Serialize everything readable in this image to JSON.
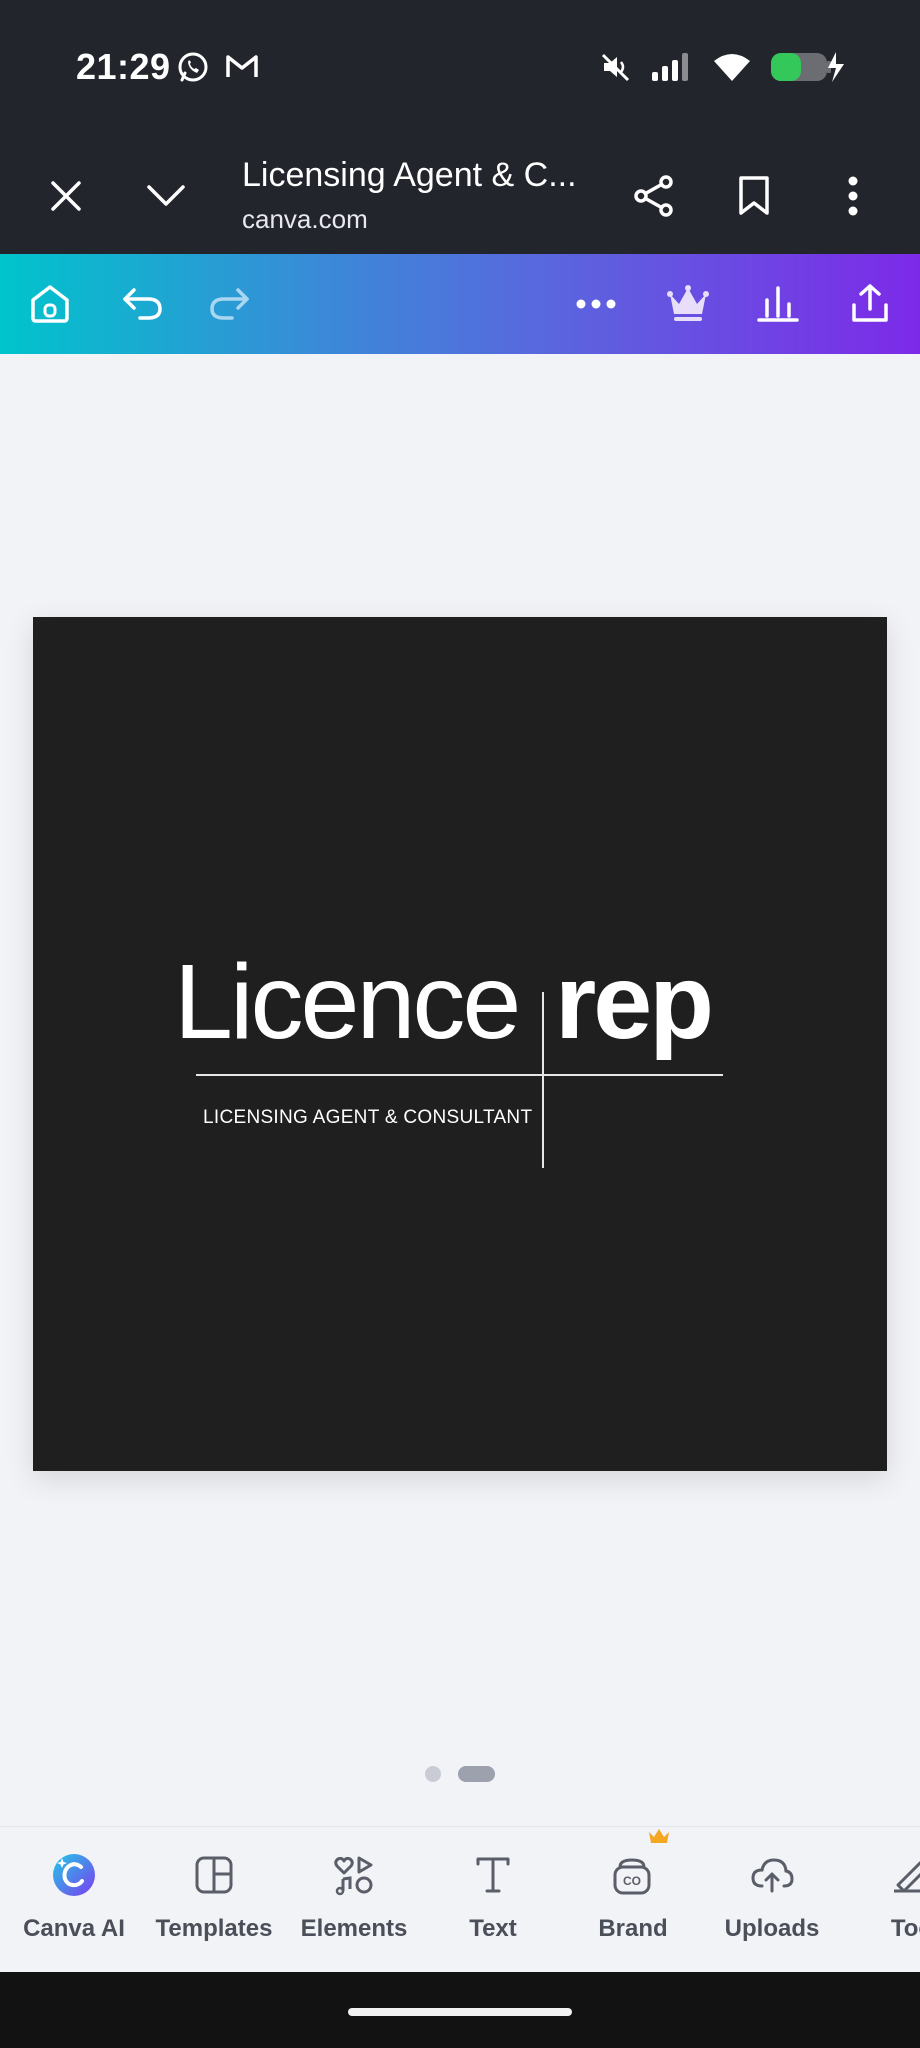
{
  "status_bar": {
    "time": "21:29",
    "icons": [
      "whatsapp-icon",
      "gmail-icon",
      "mute-icon",
      "signal-icon",
      "wifi-icon",
      "battery-charging-icon"
    ],
    "battery_color": "#34c759"
  },
  "browser": {
    "title": "Licensing Agent & C...",
    "url": "canva.com",
    "icons": [
      "close-icon",
      "chevron-down-icon",
      "share-icon",
      "bookmark-icon",
      "more-vertical-icon"
    ]
  },
  "toolbar": {
    "icons": [
      "home-icon",
      "undo-icon",
      "redo-icon",
      "more-horizontal-icon",
      "crown-icon",
      "insights-icon",
      "share-upload-icon"
    ],
    "gradient": [
      "#00c4cc",
      "#7d2ae8"
    ]
  },
  "design": {
    "background": "#1f1f1f",
    "logo_word1": "Licence",
    "logo_word2": "rep",
    "logo_subtitle": "LICENSING AGENT & CONSULTANT"
  },
  "pagination": {
    "pages": 2,
    "current": 2
  },
  "bottom_nav": {
    "items": [
      {
        "label": "Canva AI",
        "icon": "canva-ai-icon"
      },
      {
        "label": "Templates",
        "icon": "templates-icon"
      },
      {
        "label": "Elements",
        "icon": "elements-icon"
      },
      {
        "label": "Text",
        "icon": "text-icon"
      },
      {
        "label": "Brand",
        "icon": "brand-icon"
      },
      {
        "label": "Uploads",
        "icon": "uploads-icon"
      },
      {
        "label": "Too",
        "icon": "tools-icon"
      }
    ]
  }
}
